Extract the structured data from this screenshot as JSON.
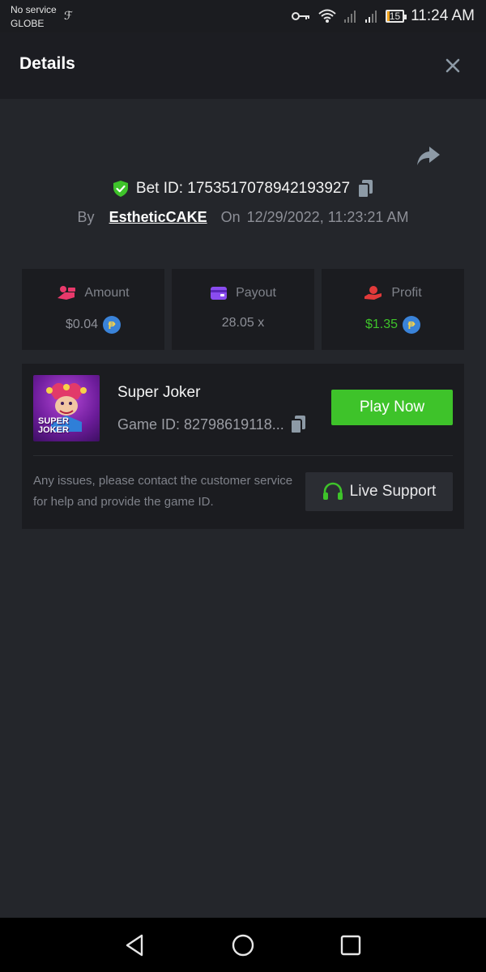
{
  "status_bar": {
    "carrier_line1": "No service",
    "carrier_line2": "GLOBE",
    "battery_level": "15",
    "time": "11:24 AM",
    "icons": [
      "key-icon",
      "wifi-icon",
      "signal-icon",
      "signal-icon",
      "battery-icon"
    ]
  },
  "header": {
    "title": "Details"
  },
  "bet": {
    "id_label": "Bet ID: 1753517078942193927",
    "by_label": "By",
    "user": "EstheticCAKE",
    "on_label": "On",
    "datetime": "12/29/2022, 11:23:21 AM"
  },
  "stats": {
    "amount": {
      "label": "Amount",
      "value": "$0.04"
    },
    "payout": {
      "label": "Payout",
      "value": "28.05 x"
    },
    "profit": {
      "label": "Profit",
      "value": "$1.35"
    }
  },
  "game": {
    "title": "Super Joker",
    "thumb_line1": "SUPER",
    "thumb_line2": "JOKER",
    "id_label": "Game ID: 82798619118...",
    "play_label": "Play Now",
    "issue_text": "Any issues, please contact the customer service for help and provide the game ID.",
    "support_label": "Live Support"
  },
  "colors": {
    "accent_green": "#3ec32a",
    "background": "#24262b",
    "card": "#1b1c20"
  }
}
